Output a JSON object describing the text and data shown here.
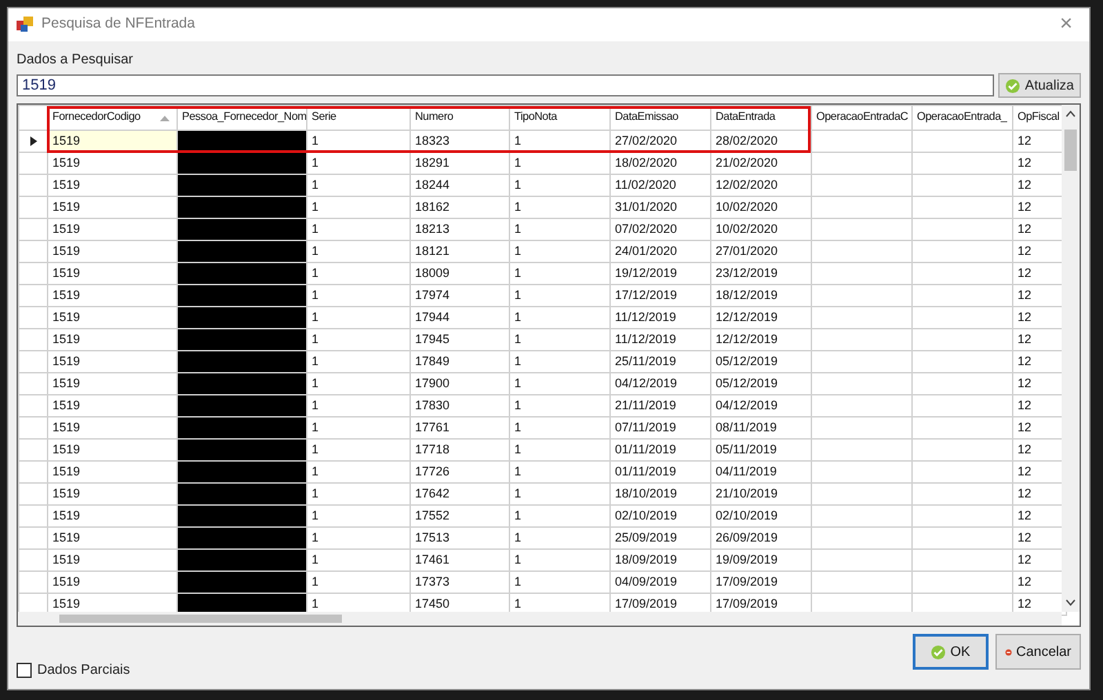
{
  "window": {
    "title": "Pesquisa de NFEntrada",
    "close": "×"
  },
  "search": {
    "label": "Dados a Pesquisar",
    "value": "1519",
    "button": "Atualiza"
  },
  "table": {
    "outline_visible": true,
    "columns": [
      {
        "label": "FornecedorCodigo",
        "sorted": true
      },
      {
        "label": "Pessoa_Fornecedor_Nom",
        "sorted": false
      },
      {
        "label": "Serie",
        "sorted": false
      },
      {
        "label": "Numero",
        "sorted": false
      },
      {
        "label": "TipoNota",
        "sorted": false
      },
      {
        "label": "DataEmissao",
        "sorted": false
      },
      {
        "label": "DataEntrada",
        "sorted": false
      },
      {
        "label": "OperacaoEntradaC",
        "sorted": false
      },
      {
        "label": "OperacaoEntrada_",
        "sorted": false
      },
      {
        "label": "OpFiscal",
        "sorted": false
      }
    ],
    "rows": [
      {
        "selected": true,
        "redacted": true,
        "codigo": "1519",
        "serie": "1",
        "numero": "18323",
        "tipo_nota": "1",
        "data_emissao": "27/02/2020",
        "data_entrada": "28/02/2020",
        "op_fiscal": "12"
      },
      {
        "selected": false,
        "redacted": true,
        "codigo": "1519",
        "serie": "1",
        "numero": "18291",
        "tipo_nota": "1",
        "data_emissao": "18/02/2020",
        "data_entrada": "21/02/2020",
        "op_fiscal": "12"
      },
      {
        "selected": false,
        "redacted": true,
        "codigo": "1519",
        "serie": "1",
        "numero": "18244",
        "tipo_nota": "1",
        "data_emissao": "11/02/2020",
        "data_entrada": "12/02/2020",
        "op_fiscal": "12"
      },
      {
        "selected": false,
        "redacted": true,
        "codigo": "1519",
        "serie": "1",
        "numero": "18162",
        "tipo_nota": "1",
        "data_emissao": "31/01/2020",
        "data_entrada": "10/02/2020",
        "op_fiscal": "12"
      },
      {
        "selected": false,
        "redacted": true,
        "codigo": "1519",
        "serie": "1",
        "numero": "18213",
        "tipo_nota": "1",
        "data_emissao": "07/02/2020",
        "data_entrada": "10/02/2020",
        "op_fiscal": "12"
      },
      {
        "selected": false,
        "redacted": true,
        "codigo": "1519",
        "serie": "1",
        "numero": "18121",
        "tipo_nota": "1",
        "data_emissao": "24/01/2020",
        "data_entrada": "27/01/2020",
        "op_fiscal": "12"
      },
      {
        "selected": false,
        "redacted": true,
        "codigo": "1519",
        "serie": "1",
        "numero": "18009",
        "tipo_nota": "1",
        "data_emissao": "19/12/2019",
        "data_entrada": "23/12/2019",
        "op_fiscal": "12"
      },
      {
        "selected": false,
        "redacted": true,
        "codigo": "1519",
        "serie": "1",
        "numero": "17974",
        "tipo_nota": "1",
        "data_emissao": "17/12/2019",
        "data_entrada": "18/12/2019",
        "op_fiscal": "12"
      },
      {
        "selected": false,
        "redacted": true,
        "codigo": "1519",
        "serie": "1",
        "numero": "17944",
        "tipo_nota": "1",
        "data_emissao": "11/12/2019",
        "data_entrada": "12/12/2019",
        "op_fiscal": "12"
      },
      {
        "selected": false,
        "redacted": true,
        "codigo": "1519",
        "serie": "1",
        "numero": "17945",
        "tipo_nota": "1",
        "data_emissao": "11/12/2019",
        "data_entrada": "12/12/2019",
        "op_fiscal": "12"
      },
      {
        "selected": false,
        "redacted": true,
        "codigo": "1519",
        "serie": "1",
        "numero": "17849",
        "tipo_nota": "1",
        "data_emissao": "25/11/2019",
        "data_entrada": "05/12/2019",
        "op_fiscal": "12"
      },
      {
        "selected": false,
        "redacted": true,
        "codigo": "1519",
        "serie": "1",
        "numero": "17900",
        "tipo_nota": "1",
        "data_emissao": "04/12/2019",
        "data_entrada": "05/12/2019",
        "op_fiscal": "12"
      },
      {
        "selected": false,
        "redacted": true,
        "codigo": "1519",
        "serie": "1",
        "numero": "17830",
        "tipo_nota": "1",
        "data_emissao": "21/11/2019",
        "data_entrada": "04/12/2019",
        "op_fiscal": "12"
      },
      {
        "selected": false,
        "redacted": true,
        "codigo": "1519",
        "serie": "1",
        "numero": "17761",
        "tipo_nota": "1",
        "data_emissao": "07/11/2019",
        "data_entrada": "08/11/2019",
        "op_fiscal": "12"
      },
      {
        "selected": false,
        "redacted": true,
        "codigo": "1519",
        "serie": "1",
        "numero": "17718",
        "tipo_nota": "1",
        "data_emissao": "01/11/2019",
        "data_entrada": "05/11/2019",
        "op_fiscal": "12"
      },
      {
        "selected": false,
        "redacted": true,
        "codigo": "1519",
        "serie": "1",
        "numero": "17726",
        "tipo_nota": "1",
        "data_emissao": "01/11/2019",
        "data_entrada": "04/11/2019",
        "op_fiscal": "12"
      },
      {
        "selected": false,
        "redacted": true,
        "codigo": "1519",
        "serie": "1",
        "numero": "17642",
        "tipo_nota": "1",
        "data_emissao": "18/10/2019",
        "data_entrada": "21/10/2019",
        "op_fiscal": "12"
      },
      {
        "selected": false,
        "redacted": true,
        "codigo": "1519",
        "serie": "1",
        "numero": "17552",
        "tipo_nota": "1",
        "data_emissao": "02/10/2019",
        "data_entrada": "02/10/2019",
        "op_fiscal": "12"
      },
      {
        "selected": false,
        "redacted": true,
        "codigo": "1519",
        "serie": "1",
        "numero": "17513",
        "tipo_nota": "1",
        "data_emissao": "25/09/2019",
        "data_entrada": "26/09/2019",
        "op_fiscal": "12"
      },
      {
        "selected": false,
        "redacted": true,
        "codigo": "1519",
        "serie": "1",
        "numero": "17461",
        "tipo_nota": "1",
        "data_emissao": "18/09/2019",
        "data_entrada": "19/09/2019",
        "op_fiscal": "12"
      },
      {
        "selected": false,
        "redacted": true,
        "codigo": "1519",
        "serie": "1",
        "numero": "17373",
        "tipo_nota": "1",
        "data_emissao": "04/09/2019",
        "data_entrada": "17/09/2019",
        "op_fiscal": "12"
      },
      {
        "selected": false,
        "redacted": true,
        "codigo": "1519",
        "serie": "1",
        "numero": "17450",
        "tipo_nota": "1",
        "data_emissao": "17/09/2019",
        "data_entrada": "17/09/2019",
        "op_fiscal": "12"
      }
    ]
  },
  "options": {
    "partial_label": "Dados Parciais",
    "partial_checked": false
  },
  "buttons": [
    {
      "kind": "ok",
      "label": "OK",
      "default": true
    },
    {
      "kind": "cancel",
      "label": "Cancelar",
      "default": false
    }
  ]
}
